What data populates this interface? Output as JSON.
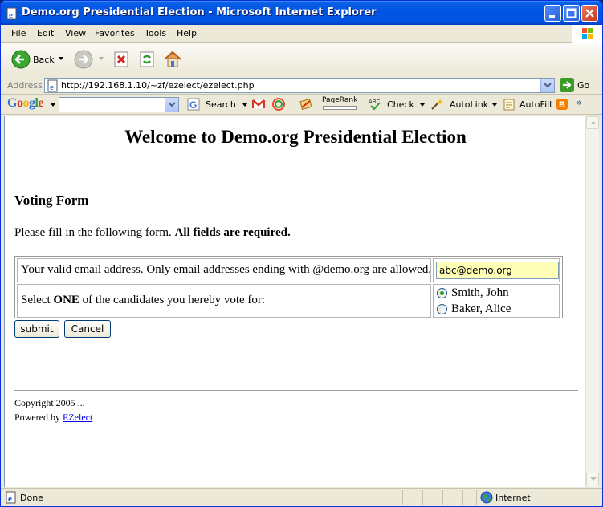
{
  "window": {
    "title": "Demo.org Presidential Election - Microsoft Internet Explorer"
  },
  "menu": [
    "File",
    "Edit",
    "View",
    "Favorites",
    "Tools",
    "Help"
  ],
  "toolbar": {
    "back_label": "Back"
  },
  "address": {
    "label": "Address",
    "url": "http://192.168.1.10/~zf/ezelect/ezelect.php",
    "go_label": "Go"
  },
  "google_toolbar": {
    "logo": "Google",
    "search_label": "Search",
    "pagerank_label": "PageRank",
    "check_label": "Check",
    "autolink_label": "AutoLink",
    "autofill_label": "AutoFill",
    "more": "»"
  },
  "page": {
    "title": "Welcome to Demo.org Presidential Election",
    "form_heading": "Voting Form",
    "instructions_plain": "Please fill in the following form.",
    "instructions_bold": "All fields are required.",
    "email_prompt": "Your valid email address. Only email addresses ending with @demo.org are allowed.",
    "email_value": "abc@demo.org",
    "vote_prompt_pre": "Select",
    "vote_prompt_bold": "ONE",
    "vote_prompt_post": "of the candidates you hereby vote for:",
    "candidates": [
      {
        "label": "Smith, John",
        "selected": true
      },
      {
        "label": "Baker, Alice",
        "selected": false
      }
    ],
    "submit_label": "submit",
    "cancel_label": "Cancel",
    "copyright": "Copyright 2005 ...",
    "powered_by": "Powered by",
    "powered_link": "EZelect"
  },
  "status": {
    "text": "Done",
    "zone": "Internet"
  },
  "colors": {
    "titlebar": "#0054e3",
    "email_field_bg": "#ffffb8",
    "link": "#0000ee"
  }
}
